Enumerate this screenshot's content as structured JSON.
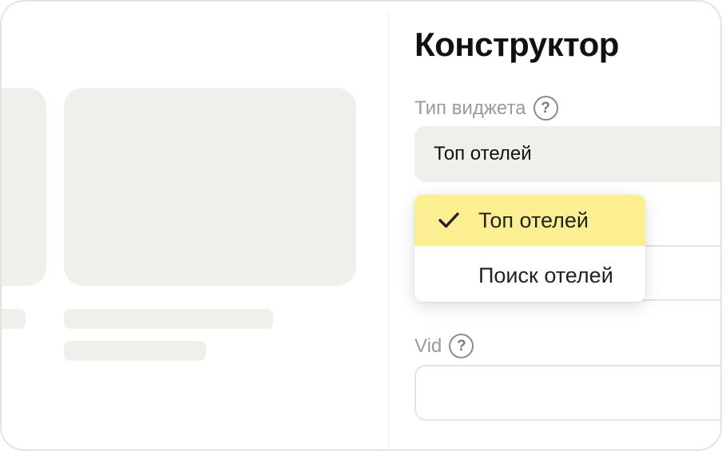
{
  "panel": {
    "title": "Конструктор"
  },
  "widget_type": {
    "label": "Тип виджета",
    "help_glyph": "?",
    "selected_value": "Топ отелей",
    "options": [
      {
        "label": "Топ отелей",
        "selected": true
      },
      {
        "label": "Поиск отелей",
        "selected": false
      }
    ]
  },
  "vid": {
    "label": "Vid",
    "help_glyph": "?",
    "value": ""
  },
  "colors": {
    "selected_option_bg": "#fcef91",
    "skeleton": "#f0efec",
    "select_bg": "#f0efec"
  },
  "icons": {
    "help": "question-circle-icon",
    "check": "checkmark-icon"
  }
}
